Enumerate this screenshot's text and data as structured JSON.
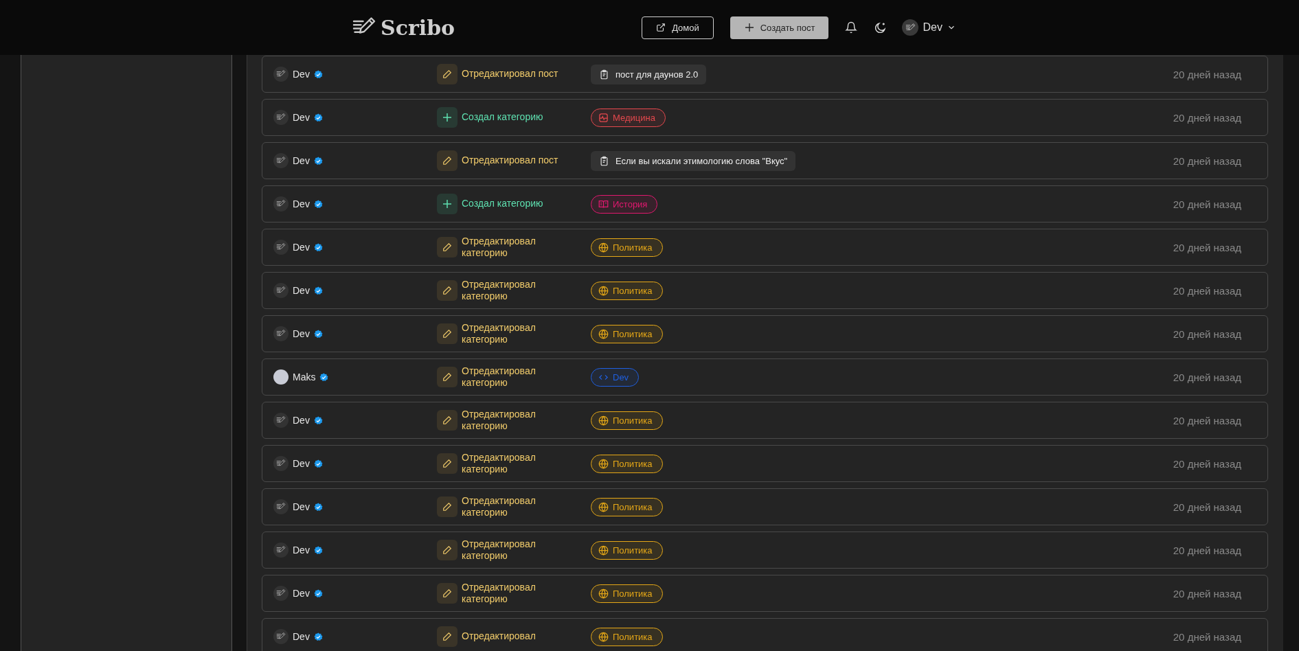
{
  "header": {
    "logo": "Scribo",
    "home_button": "Домой",
    "create_button": "Создать пост",
    "user": "Dev"
  },
  "rows": [
    {
      "user": "Dev",
      "avatar": {
        "kind": "logo"
      },
      "verified": true,
      "action": {
        "kind": "edit",
        "label": "Отредактировал пост"
      },
      "target": {
        "kind": "post",
        "label": "пост для даунов 2.0"
      },
      "time": "20 дней назад"
    },
    {
      "user": "Dev",
      "avatar": {
        "kind": "logo"
      },
      "verified": true,
      "action": {
        "kind": "create",
        "label": "Создал категорию"
      },
      "target": {
        "kind": "pulse",
        "label": "Медицина",
        "color": "#e5484d"
      },
      "time": "20 дней назад"
    },
    {
      "user": "Dev",
      "avatar": {
        "kind": "logo"
      },
      "verified": true,
      "action": {
        "kind": "edit",
        "label": "Отредактировал пост"
      },
      "target": {
        "kind": "post",
        "label": "Если вы искали этимологию слова \"Вкус\""
      },
      "time": "20 дней назад"
    },
    {
      "user": "Dev",
      "avatar": {
        "kind": "logo"
      },
      "verified": true,
      "action": {
        "kind": "create",
        "label": "Создал категорию"
      },
      "target": {
        "kind": "book",
        "label": "История",
        "color": "#e2186f"
      },
      "time": "20 дней назад"
    },
    {
      "user": "Dev",
      "avatar": {
        "kind": "logo"
      },
      "verified": true,
      "action": {
        "kind": "edit",
        "label": "Отредактировал категорию"
      },
      "target": {
        "kind": "globe",
        "label": "Политика",
        "color": "#e6a817"
      },
      "time": "20 дней назад"
    },
    {
      "user": "Dev",
      "avatar": {
        "kind": "logo"
      },
      "verified": true,
      "action": {
        "kind": "edit",
        "label": "Отредактировал категорию"
      },
      "target": {
        "kind": "globe",
        "label": "Политика",
        "color": "#e6a817"
      },
      "time": "20 дней назад"
    },
    {
      "user": "Dev",
      "avatar": {
        "kind": "logo"
      },
      "verified": true,
      "action": {
        "kind": "edit",
        "label": "Отредактировал категорию"
      },
      "target": {
        "kind": "globe",
        "label": "Политика",
        "color": "#e6a817"
      },
      "time": "20 дней назад"
    },
    {
      "user": "Maks",
      "avatar": {
        "kind": "photo"
      },
      "verified": true,
      "action": {
        "kind": "edit",
        "label": "Отредактировал категорию"
      },
      "target": {
        "kind": "code",
        "label": "Dev",
        "color": "#1f5fe0"
      },
      "time": "20 дней назад"
    },
    {
      "user": "Dev",
      "avatar": {
        "kind": "logo"
      },
      "verified": true,
      "action": {
        "kind": "edit",
        "label": "Отредактировал категорию"
      },
      "target": {
        "kind": "globe",
        "label": "Политика",
        "color": "#e6a817"
      },
      "time": "20 дней назад"
    },
    {
      "user": "Dev",
      "avatar": {
        "kind": "logo"
      },
      "verified": true,
      "action": {
        "kind": "edit",
        "label": "Отредактировал категорию"
      },
      "target": {
        "kind": "globe",
        "label": "Политика",
        "color": "#e6a817"
      },
      "time": "20 дней назад"
    },
    {
      "user": "Dev",
      "avatar": {
        "kind": "logo"
      },
      "verified": true,
      "action": {
        "kind": "edit",
        "label": "Отредактировал категорию"
      },
      "target": {
        "kind": "globe",
        "label": "Политика",
        "color": "#e6a817"
      },
      "time": "20 дней назад"
    },
    {
      "user": "Dev",
      "avatar": {
        "kind": "logo"
      },
      "verified": true,
      "action": {
        "kind": "edit",
        "label": "Отредактировал категорию"
      },
      "target": {
        "kind": "globe",
        "label": "Политика",
        "color": "#e6a817"
      },
      "time": "20 дней назад"
    },
    {
      "user": "Dev",
      "avatar": {
        "kind": "logo"
      },
      "verified": true,
      "action": {
        "kind": "edit",
        "label": "Отредактировал категорию"
      },
      "target": {
        "kind": "globe",
        "label": "Политика",
        "color": "#e6a817"
      },
      "time": "20 дней назад"
    },
    {
      "user": "Dev",
      "avatar": {
        "kind": "logo"
      },
      "verified": true,
      "action": {
        "kind": "edit",
        "label": "Отредактировал"
      },
      "target": {
        "kind": "globe",
        "label": "Политика",
        "color": "#e6a817"
      },
      "time": "20 дней назад"
    }
  ]
}
